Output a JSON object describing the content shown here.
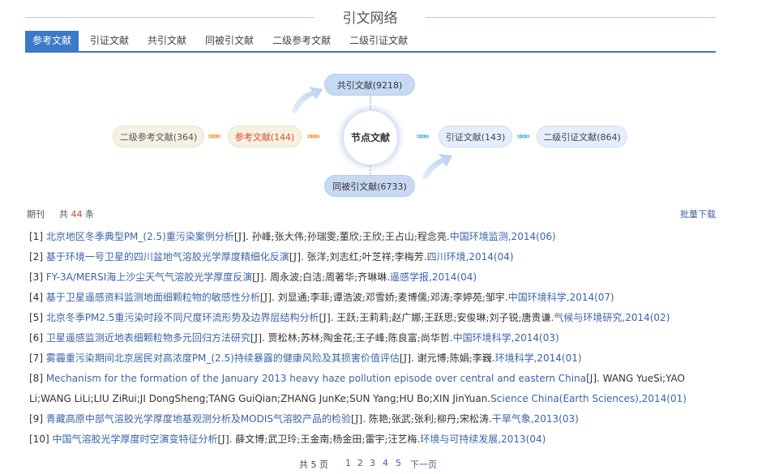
{
  "header": {
    "title": "引文网络"
  },
  "tabs": [
    {
      "label": "参考文献"
    },
    {
      "label": "引证文献"
    },
    {
      "label": "共引文献"
    },
    {
      "label": "同被引文献"
    },
    {
      "label": "二级参考文献"
    },
    {
      "label": "二级引证文献"
    }
  ],
  "network": {
    "center": "节点文献",
    "co_cited": "共引文献(9218)",
    "co_citing": "同被引文献(6733)",
    "secondary_references": "二级参考文献(364)",
    "references": "参考文献(144)",
    "citing": "引证文献(143)",
    "secondary_citing": "二级引证文献(864)",
    "chevrons": "»»»"
  },
  "list": {
    "label": "期刊",
    "count_prefix": "共",
    "count": "44",
    "count_suffix": "条",
    "batch_download": "批量下载"
  },
  "references": [
    {
      "num": "[1] ",
      "title": "北京地区冬季典型PM_(2.5)重污染案例分析",
      "authors": "[J]. 孙峰;张大伟;孙瑞雯;董欣;王欣;王占山;程念亮.",
      "source": "中国环境监测,2014(06)"
    },
    {
      "num": "[2] ",
      "title": "基于环境一号卫星的四川盆地气溶胶光学厚度精细化反演",
      "authors": "[J]. 张洋;刘志红;叶芝祥;李梅芳.",
      "source": "四川环境,2014(04)"
    },
    {
      "num": "[3] ",
      "title": "FY-3A/MERSI海上沙尘天气气溶胶光学厚度反演",
      "authors": "[J]. 周永波;白洁;周著华;齐琳琳.",
      "source": "遥感学报,2014(04)"
    },
    {
      "num": "[4] ",
      "title": "基于卫星遥感资料监测地面细颗粒物的敏感性分析",
      "authors": "[J]. 刘显通;李菲;谭浩波;邓雪娇;麦博儒;邓涛;李婷苑;邹宇.",
      "source": "中国环境科学,2014(07)"
    },
    {
      "num": "[5] ",
      "title": "北京冬季PM2.5重污染时段不同尺度环流形势及边界层结构分析",
      "authors": "[J]. 王跃;王莉莉;赵广娜;王跃思;安俊琳;刘子锐;唐贵谦.",
      "source": "气候与环境研究,2014(02)"
    },
    {
      "num": "[6] ",
      "title": "卫星遥感监测近地表细颗粒物多元回归方法研究",
      "authors": "[J]. 贾松林;苏林;陶金花;王子峰;陈良富;尚华哲.",
      "source": "中国环境科学,2014(03)"
    },
    {
      "num": "[7] ",
      "title": "雾霾重污染期间北京居民对高浓度PM_(2.5)持续暴露的健康风险及其损害价值评估",
      "authors": "[J]. 谢元博;陈娟;李巍.",
      "source": "环境科学,2014(01)"
    },
    {
      "num": "[8] ",
      "title": "Mechanism for the formation of the January 2013 heavy haze pollution episode over central and eastern China",
      "authors": "[J]. WANG YueSi;YAO Li;WANG LiLi;LIU ZiRui;JI DongSheng;TANG GuiQian;ZHANG JunKe;SUN Yang;HU Bo;XIN JinYuan.",
      "source": "Science China(Earth Sciences),2014(01)"
    },
    {
      "num": "[9] ",
      "title": "青藏高原中部气溶胶光学厚度地基观测分析及MODIS气溶胶产品的检验",
      "authors": "[J]. 陈艳;张武;张利;柳丹;宋松涛.",
      "source": "干旱气象,2013(03)"
    },
    {
      "num": "[10] ",
      "title": "中国气溶胶光学厚度时空演变特征分析",
      "authors": "[J]. 薛文博;武卫玲;王金南;杨金田;雷宇;汪艺梅.",
      "source": "环境与可持续发展,2013(04)"
    }
  ],
  "pagination": {
    "total": "共 5 页",
    "pages": [
      "1",
      "2",
      "3",
      "4",
      "5"
    ],
    "next": "下一页"
  },
  "colors": {
    "accent": "#3d79c6",
    "link": "#3b63a8",
    "highlight": "#e34b25"
  }
}
